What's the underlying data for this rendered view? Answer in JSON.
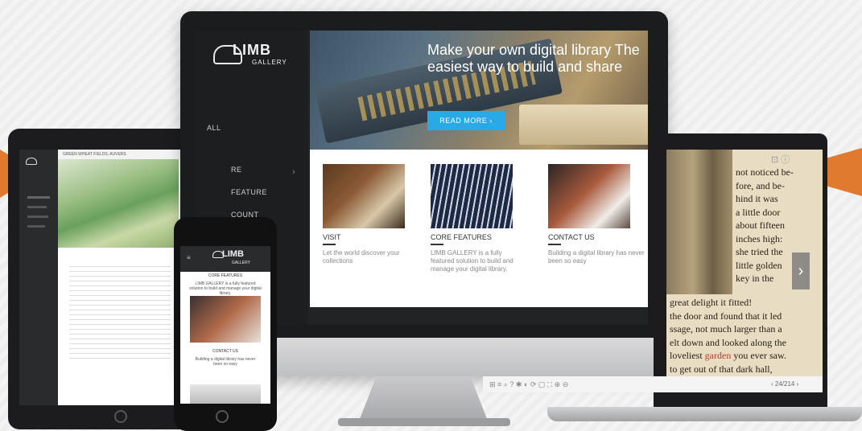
{
  "desktop": {
    "logo": {
      "primary": "LIMB",
      "secondary": "GALLERY"
    },
    "nav": [
      "ALL",
      "RE",
      "FEATURE",
      "COUNT"
    ],
    "hero": {
      "title": "Make your own digital library The easiest way to build and share",
      "button_label": "READ MORE"
    },
    "cards": [
      {
        "title": "VISIT",
        "text": "Let the world discover your collections"
      },
      {
        "title": "CORE FEATURES",
        "text": "LIMB GALLERY is a fully featured solution to build and manage your digital library."
      },
      {
        "title": "CONTACT US",
        "text": "Building a digital library has never been so easy"
      }
    ]
  },
  "tablet": {
    "title": "GREEN WHEAT FIELDS, AUVERS"
  },
  "phone": {
    "logo": {
      "primary": "LIMB",
      "secondary": "GALLERY"
    },
    "section1": "CORE FEATURES",
    "section1_text": "LIMB GALLERY is a fully featured solution to build and manage your digital library.",
    "section2": "CONTACT US",
    "section2_text": "Building a digital library has never been so easy"
  },
  "laptop": {
    "lines_right": [
      "not noticed be-",
      "fore, and be-",
      "hind it was",
      "a little door",
      "about fifteen",
      "inches high:",
      "she tried the",
      "little golden",
      "key in the"
    ],
    "lines_full": [
      "great delight it fitted!",
      "the door and found that it led",
      "ssage, not much larger than a",
      "elt down and looked along the",
      "loveliest",
      "garden",
      "you ever saw.",
      "to get out of that dark hall,"
    ],
    "pager": "24/214"
  },
  "colors": {
    "accent": "#29a9e6",
    "ribbon": "#e07a2f"
  },
  "icons": [
    "cloud-logo-icon",
    "chevron-right-icon",
    "info-icon"
  ]
}
